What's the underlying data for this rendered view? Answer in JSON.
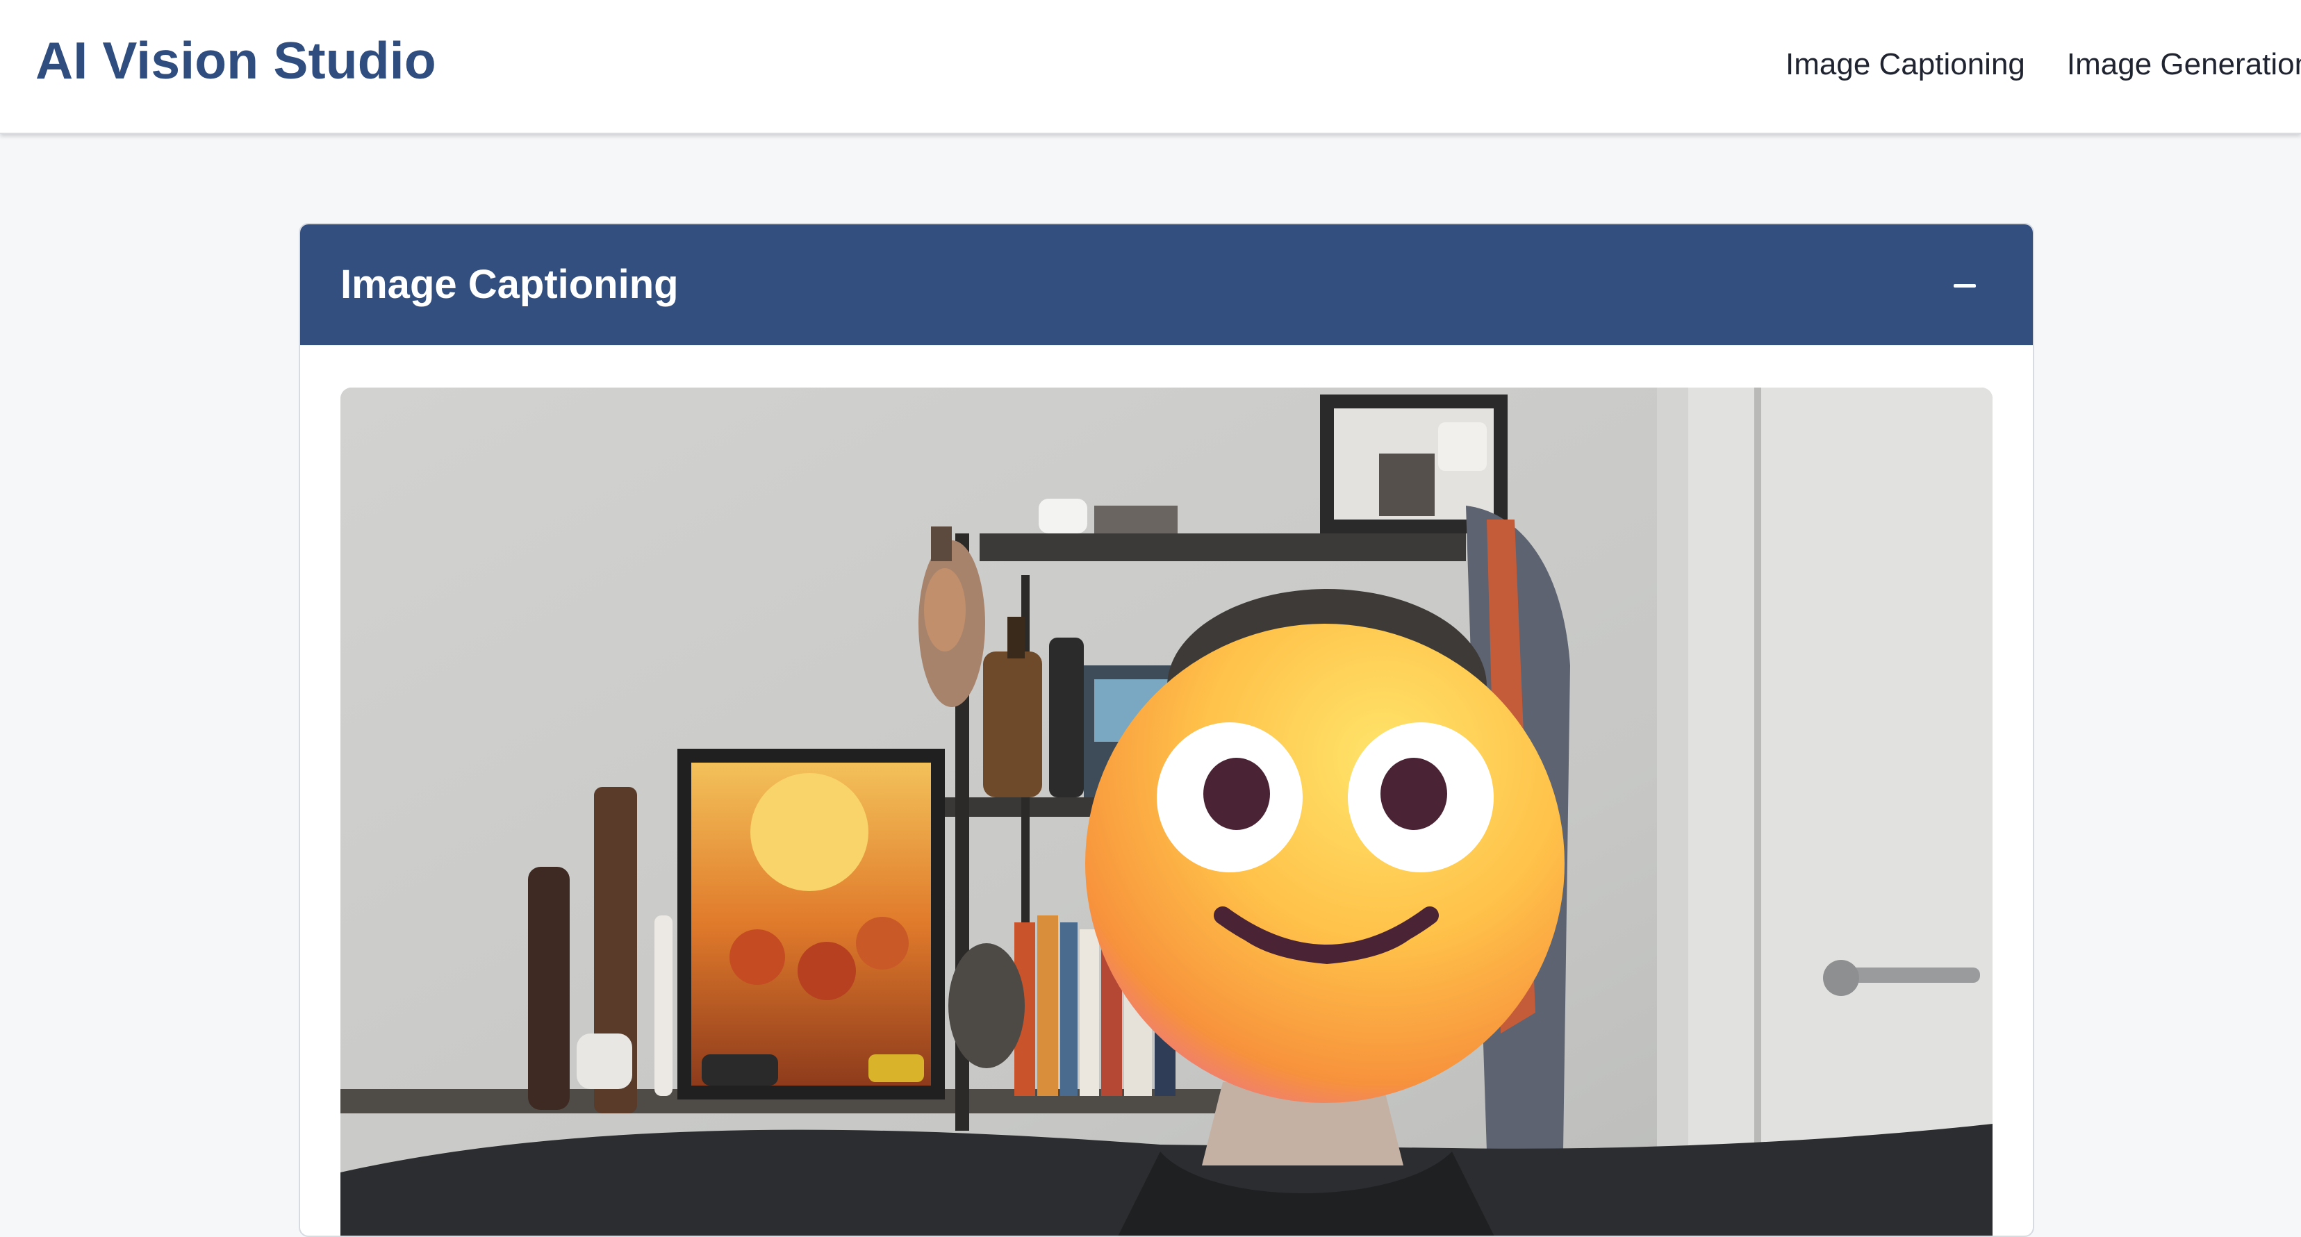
{
  "app": {
    "title": "AI Vision Studio"
  },
  "nav": {
    "items": [
      {
        "label": "Image Captioning"
      },
      {
        "label": "Image Generation"
      }
    ]
  },
  "panel": {
    "title": "Image Captioning",
    "collapse_icon": "minus-icon"
  },
  "image": {
    "subject": "webcam-frame"
  },
  "colors": {
    "brand": "#2f4d7e",
    "panel_header": "#334f7f",
    "background": "#f6f7f9"
  }
}
